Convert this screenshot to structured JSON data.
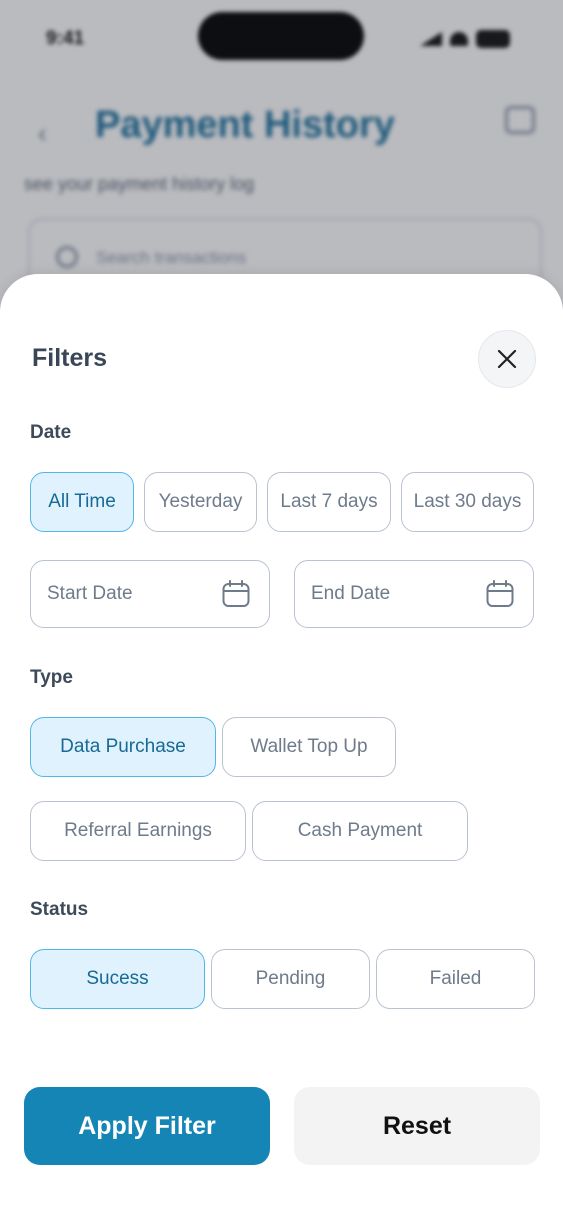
{
  "background": {
    "time": "9:41",
    "title": "Payment History",
    "subtitle": "see your payment history log",
    "search_placeholder": "Search transactions"
  },
  "sheet": {
    "title": "Filters",
    "close_icon": "close-icon",
    "date": {
      "label": "Date",
      "options": [
        "All Time",
        "Yesterday",
        "Last 7 days",
        "Last 30 days"
      ],
      "selected": "All Time",
      "start_placeholder": "Start Date",
      "end_placeholder": "End Date",
      "calendar_icon": "calendar-icon"
    },
    "type": {
      "label": "Type",
      "options": [
        "Data Purchase",
        "Wallet Top Up",
        "Referral Earnings",
        "Cash Payment"
      ],
      "selected": "Data Purchase"
    },
    "status": {
      "label": "Status",
      "options": [
        "Sucess",
        "Pending",
        "Failed"
      ],
      "selected": "Sucess"
    },
    "apply_label": "Apply Filter",
    "reset_label": "Reset"
  },
  "colors": {
    "primary": "#1585b5",
    "chip_active_bg": "#dff2fd",
    "chip_active_border": "#52b6e6",
    "chip_active_text": "#176a95"
  }
}
